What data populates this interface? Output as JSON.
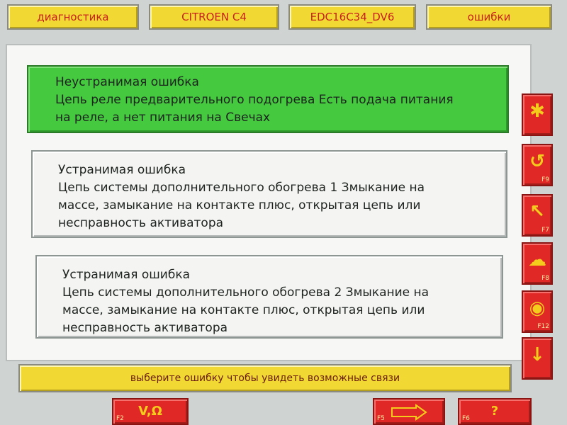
{
  "tabs": [
    {
      "label": "диагностика"
    },
    {
      "label": "CITROEN C4"
    },
    {
      "label": "EDC16C34_DV6"
    },
    {
      "label": "ошибки"
    }
  ],
  "faults": [
    {
      "type": "Неустранимая ошибка",
      "lines": [
        "Цепь реле предварительного подогрева Есть подача питания",
        "на реле, а нет питания на Свечах"
      ],
      "selected": true
    },
    {
      "type": "Устранимая ошибка",
      "lines": [
        "Цепь системы дополнительного обогрева 1 Змыкание на",
        "массе, замыкание на контакте плюс, открытая цепь или",
        "несправность активатора"
      ],
      "selected": false
    },
    {
      "type": "Устранимая ошибка",
      "lines": [
        "Цепь системы дополнительного обогрева 2 Змыкание на",
        "массе, замыкание на контакте плюс, открытая цепь или",
        "несправность активатора"
      ],
      "selected": false
    }
  ],
  "status_text": "выберите ошибку чтобы увидеть возможные связи",
  "side_keys": [
    {
      "icon": "asterisk-icon",
      "glyph": "✱",
      "key": ""
    },
    {
      "icon": "undo-arrow-icon",
      "glyph": "↺",
      "key": "F9"
    },
    {
      "icon": "arrow-up-left-icon",
      "glyph": "↖",
      "key": "F7"
    },
    {
      "icon": "cloud-icon",
      "glyph": "☁",
      "key": "F8"
    },
    {
      "icon": "antenna-icon",
      "glyph": "◉",
      "key": "F12"
    },
    {
      "icon": "arrow-down-icon",
      "glyph": "↓",
      "key": ""
    }
  ],
  "bottom_keys": [
    {
      "key": "F2",
      "label": "V,Ω",
      "icon": "meter-icon"
    },
    {
      "key": "F5",
      "label": "",
      "icon": "connector-icon"
    },
    {
      "key": "F6",
      "label": "?",
      "icon": "help-icon"
    }
  ],
  "colors": {
    "tab_yellow": "#f2d832",
    "tab_text_red": "#c8201e",
    "selected_green": "#44c93f",
    "key_red": "#e02826",
    "key_glyph_yellow": "#f4cc1c"
  }
}
